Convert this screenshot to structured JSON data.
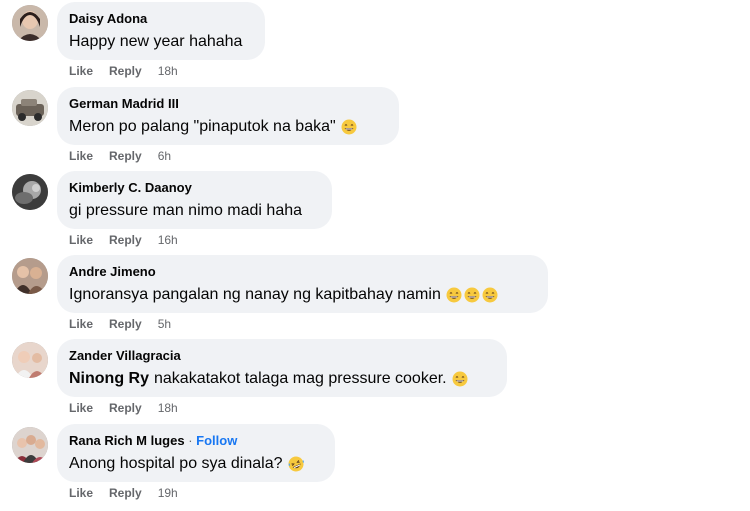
{
  "comments": [
    {
      "name": "Daisy Adona",
      "text": "Happy new year hahaha",
      "like": "Like",
      "reply": "Reply",
      "time": "18h"
    },
    {
      "name": "German Madrid III",
      "text": "Meron po palang \"pinaputok na baka\"",
      "like": "Like",
      "reply": "Reply",
      "time": "6h"
    },
    {
      "name": "Kimberly C. Daanoy",
      "text": "gi pressure man nimo madi haha",
      "like": "Like",
      "reply": "Reply",
      "time": "16h"
    },
    {
      "name": "Andre Jimeno",
      "text": "Ignoransya pangalan ng nanay ng kapitbahay namin",
      "like": "Like",
      "reply": "Reply",
      "time": "5h"
    },
    {
      "name": "Zander Villagracia",
      "mention": "Ninong Ry",
      "text": "nakakatakot talaga mag pressure cooker.",
      "like": "Like",
      "reply": "Reply",
      "time": "18h"
    },
    {
      "name": "Rana Rich M luges",
      "follow_sep": "·",
      "follow": "Follow",
      "text": "Anong hospital po sya dinala?",
      "like": "Like",
      "reply": "Reply",
      "time": "19h"
    }
  ],
  "icons": {
    "emoji_grin": "grinning-sweat-face-icon",
    "emoji_laugh": "rofl-face-icon"
  },
  "colors": {
    "bubble": "#f0f2f5",
    "follow": "#1877f2",
    "secondary_text": "#65676b"
  }
}
